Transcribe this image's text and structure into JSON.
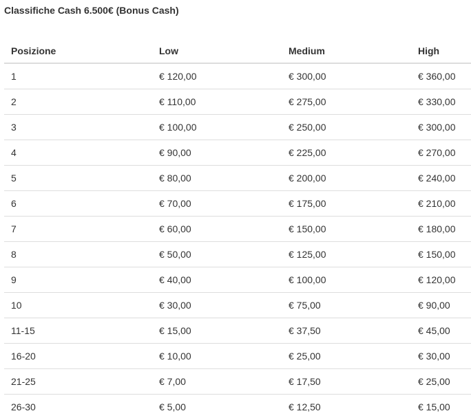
{
  "title": "Classifiche Cash 6.500€ (Bonus Cash)",
  "table": {
    "headers": [
      "Posizione",
      "Low",
      "Medium",
      "High"
    ],
    "rows": [
      [
        "1",
        "€ 120,00",
        "€ 300,00",
        "€ 360,00"
      ],
      [
        "2",
        "€ 110,00",
        "€ 275,00",
        "€ 330,00"
      ],
      [
        "3",
        "€ 100,00",
        "€ 250,00",
        "€ 300,00"
      ],
      [
        "4",
        "€ 90,00",
        "€ 225,00",
        "€ 270,00"
      ],
      [
        "5",
        "€ 80,00",
        "€ 200,00",
        "€ 240,00"
      ],
      [
        "6",
        "€ 70,00",
        "€ 175,00",
        "€ 210,00"
      ],
      [
        "7",
        "€ 60,00",
        "€ 150,00",
        "€ 180,00"
      ],
      [
        "8",
        "€ 50,00",
        "€ 125,00",
        "€ 150,00"
      ],
      [
        "9",
        "€ 40,00",
        "€ 100,00",
        "€ 120,00"
      ],
      [
        "10",
        "€ 30,00",
        "€ 75,00",
        "€ 90,00"
      ],
      [
        "11-15",
        "€ 15,00",
        "€ 37,50",
        "€ 45,00"
      ],
      [
        "16-20",
        "€ 10,00",
        "€ 25,00",
        "€ 30,00"
      ],
      [
        "21-25",
        "€ 7,00",
        "€ 17,50",
        "€ 25,00"
      ],
      [
        "26-30",
        "€ 5,00",
        "€ 12,50",
        "€ 15,00"
      ]
    ]
  }
}
